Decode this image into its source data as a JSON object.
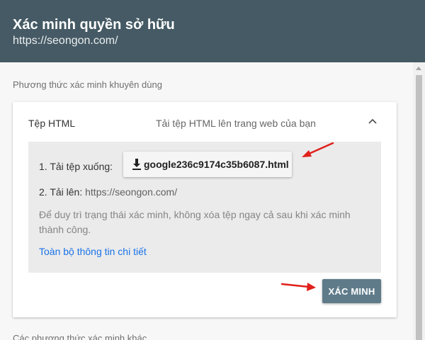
{
  "header": {
    "title": "Xác minh quyền sở hữu",
    "subtitle": "https://seongon.com/"
  },
  "main": {
    "recommended_heading": "Phương thức xác minh khuyên dùng",
    "other_methods_heading": "Các phương thức xác minh khác",
    "method_card": {
      "method_name": "Tệp HTML",
      "method_description": "Tải tệp HTML lên trang web của bạn",
      "expanded": true,
      "step1_label": "1. Tải tệp xuống:",
      "download_filename": "google236c9174c35b6087.html",
      "step2_label": "2. Tải lên:",
      "step2_url": "https://seongon.com/",
      "note": "Để duy trì trạng thái xác minh, không xóa tệp ngay cả sau khi xác minh thành công.",
      "details_link": "Toàn bộ thông tin chi tiết",
      "verify_button": "XÁC MINH"
    }
  },
  "icons": {
    "expand": "chevron-up-icon",
    "download": "download-icon",
    "annotation": "red-arrow-icon"
  },
  "colors": {
    "header_bg": "#455a64",
    "verify_button_bg": "#5f7b8a",
    "link": "#1a73e8",
    "annotation_arrow": "#e0201b"
  }
}
